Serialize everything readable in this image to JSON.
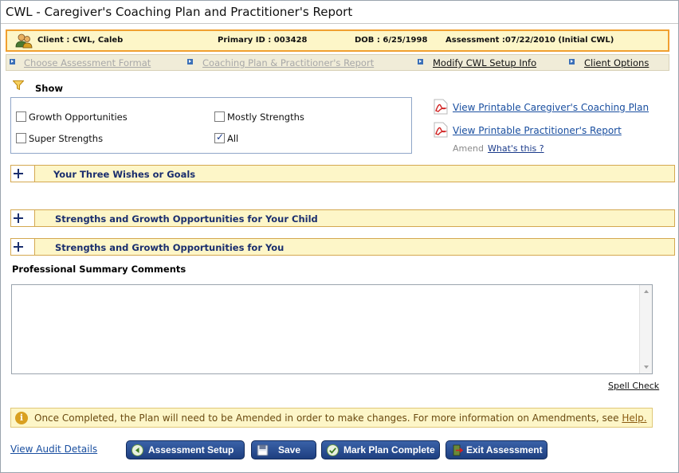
{
  "window": {
    "title": "CWL - Caregiver's Coaching Plan and Practitioner's Report"
  },
  "client": {
    "client": "Client : CWL, Caleb",
    "primary_id": "Primary ID : 003428",
    "dob": "DOB : 6/25/1998",
    "assessment": "Assessment :07/22/2010 (Initial CWL)"
  },
  "nav": {
    "items": [
      {
        "label": "Choose Assessment Format",
        "enabled": false
      },
      {
        "label": "Coaching Plan & Practitioner's Report",
        "enabled": false
      },
      {
        "label": "Modify CWL Setup Info",
        "enabled": true
      },
      {
        "label": "Client Options",
        "enabled": true
      }
    ]
  },
  "filter": {
    "label": "Show",
    "options": [
      {
        "label": "Growth Opportunities",
        "checked": false
      },
      {
        "label": "Mostly Strengths",
        "checked": false
      },
      {
        "label": "Super Strengths",
        "checked": false
      },
      {
        "label": "All",
        "checked": true
      }
    ]
  },
  "links": {
    "caregiver_plan": "View Printable Caregiver's Coaching Plan",
    "practitioner_report": "View Printable Practitioner's Report",
    "amend": "Amend",
    "whats_this": "What's this ?"
  },
  "sections": [
    {
      "title": "Your Three Wishes or Goals"
    },
    {
      "title": "Strengths and Growth Opportunities for Your Child"
    },
    {
      "title": "Strengths and Growth Opportunities for You"
    }
  ],
  "summary": {
    "label": "Professional Summary Comments",
    "value": "",
    "spell_check": "Spell Check"
  },
  "info": {
    "text": "Once Completed, the Plan will need to be Amended in order to make changes. For more information on Amendments, see ",
    "help": "Help."
  },
  "footer": {
    "audit": "View Audit Details",
    "buttons": {
      "setup": "Assessment Setup",
      "save": "Save",
      "complete": "Mark Plan Complete",
      "exit": "Exit Assessment"
    }
  },
  "colors": {
    "accent": "#1a2e6e",
    "highlight_bg": "#fdf6c8",
    "client_border": "#f0a030",
    "link": "#1a4fa0"
  }
}
